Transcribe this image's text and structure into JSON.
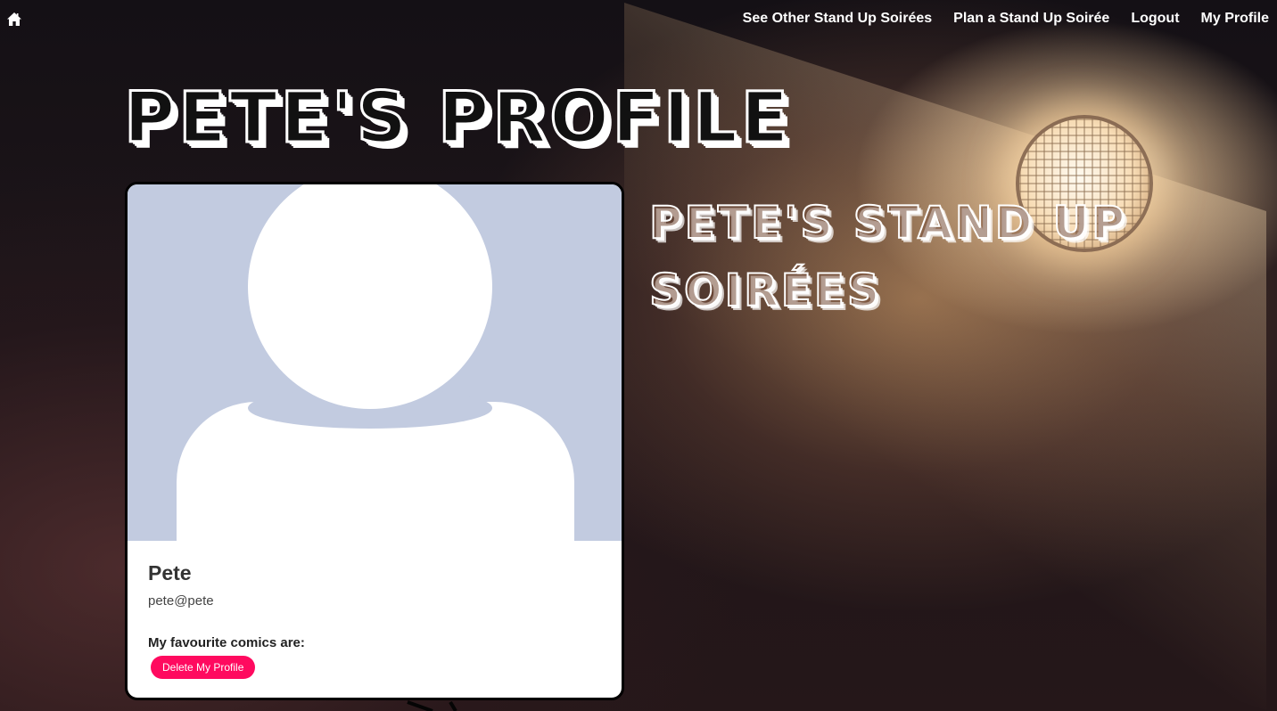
{
  "nav": {
    "home_icon": "home-icon",
    "links": [
      {
        "label": "See Other Stand Up Soirées"
      },
      {
        "label": "Plan a Stand Up Soirée"
      },
      {
        "label": "Logout"
      },
      {
        "label": "My Profile"
      }
    ]
  },
  "page": {
    "title": "Pete's Profile",
    "soirees_heading": "Pete's Stand Up Soirées"
  },
  "profile": {
    "avatar": "default-user-avatar",
    "name": "Pete",
    "email": "pete@pete",
    "favourite_comics_label": "My favourite comics are:",
    "delete_button": "Delete My Profile"
  },
  "colors": {
    "accent": "#ff0a5f",
    "avatar_bg": "#c2cbe0",
    "card_bg": "#ffffff"
  }
}
